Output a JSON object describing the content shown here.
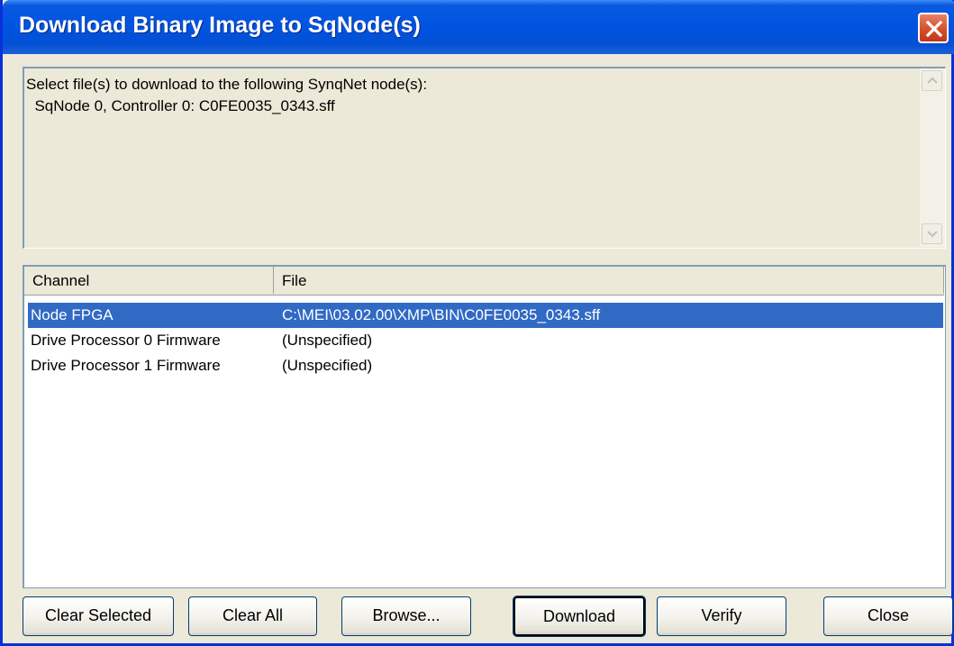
{
  "window": {
    "title": "Download Binary Image to SqNode(s)",
    "close_icon": "close-icon"
  },
  "info": {
    "line1": "Select file(s) to download to the following SynqNet node(s):",
    "line2": "  SqNode 0, Controller 0: C0FE0035_0343.sff"
  },
  "list": {
    "columns": [
      "Channel",
      "File"
    ],
    "rows": [
      {
        "channel": "Node FPGA",
        "file": "C:\\MEI\\03.02.00\\XMP\\BIN\\C0FE0035_0343.sff",
        "selected": true
      },
      {
        "channel": "Drive Processor 0 Firmware",
        "file": "(Unspecified)",
        "selected": false
      },
      {
        "channel": "Drive Processor 1 Firmware",
        "file": "(Unspecified)",
        "selected": false
      }
    ]
  },
  "buttons": {
    "clear_selected": "Clear Selected",
    "clear_all": "Clear All",
    "browse": "Browse...",
    "download": "Download",
    "verify": "Verify",
    "close": "Close"
  },
  "colors": {
    "titlebar": "#0054e3",
    "selection": "#316ac5",
    "close_button": "#d8532f",
    "dialog_bg": "#ece9d8"
  }
}
